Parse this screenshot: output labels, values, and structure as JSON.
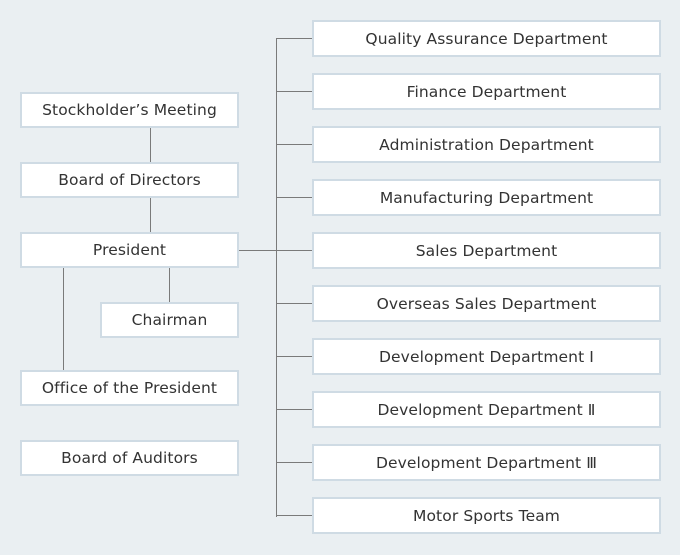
{
  "colors": {
    "background": "#eaeff2",
    "box_fill": "#ffffff",
    "box_border": "#cfdbe4",
    "connector": "#7a7a7a",
    "text": "#333333"
  },
  "left_units": [
    {
      "id": "stockholders",
      "label": "Stockholder’s Meeting"
    },
    {
      "id": "board-directors",
      "label": "Board of Directors"
    },
    {
      "id": "president",
      "label": "President"
    },
    {
      "id": "chairman",
      "label": "Chairman"
    },
    {
      "id": "office-president",
      "label": "Office of the President"
    },
    {
      "id": "board-auditors",
      "label": "Board of Auditors"
    }
  ],
  "departments": [
    {
      "label": "Quality Assurance Department"
    },
    {
      "label": "Finance Department"
    },
    {
      "label": "Administration Department"
    },
    {
      "label": "Manufacturing Department"
    },
    {
      "label": "Sales Department"
    },
    {
      "label": "Overseas Sales Department"
    },
    {
      "label": "Development Department Ⅰ"
    },
    {
      "label": "Development Department Ⅱ"
    },
    {
      "label": "Development Department Ⅲ"
    },
    {
      "label": "Motor Sports Team"
    }
  ],
  "relations": [
    {
      "from": "stockholders",
      "to": "board-directors"
    },
    {
      "from": "board-directors",
      "to": "president"
    },
    {
      "from": "president",
      "to": "chairman"
    },
    {
      "from": "president",
      "to": "office-president"
    },
    {
      "from": "president",
      "to": "departments"
    }
  ]
}
